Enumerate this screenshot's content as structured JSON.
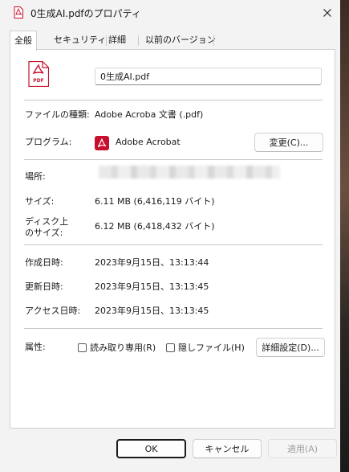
{
  "window": {
    "title": "0生成AI.pdfのプロパティ",
    "title_icon": "pdf-file-icon",
    "close_icon": "close-icon"
  },
  "tabs": [
    {
      "label": "全般",
      "active": true
    },
    {
      "label": "セキュリティ",
      "active": false
    },
    {
      "label": "詳細",
      "active": false
    },
    {
      "label": "以前のバージョン",
      "active": false
    }
  ],
  "general": {
    "file_icon": "pdf-file-icon",
    "file_icon_text": "PDF",
    "file_name": "0生成AI.pdf",
    "type_label": "ファイルの種類:",
    "type_value": "Adobe Acroba 文書 (.pdf)",
    "program_label": "プログラム:",
    "program_icon": "adobe-acrobat-icon",
    "program_value": "Adobe Acrobat",
    "change_button": "変更(C)...",
    "location_label": "場所:",
    "size_label": "サイズ:",
    "size_value": "6.11 MB (6,416,119 バイト)",
    "disk_size_label_line1": "ディスク上",
    "disk_size_label_line2": "のサイズ:",
    "disk_size_value": "6.12 MB (6,418,432 バイト)",
    "created_label": "作成日時:",
    "created_value": "2023年9月15日、13:13:44",
    "modified_label": "更新日時:",
    "modified_value": "2023年9月15日、13:13:45",
    "accessed_label": "アクセス日時:",
    "accessed_value": "2023年9月15日、13:13:45",
    "attributes_label": "属性:",
    "readonly_label": "読み取り専用(R)",
    "readonly_checked": false,
    "hidden_label": "隠しファイル(H)",
    "hidden_checked": false,
    "advanced_button": "詳細設定(D)..."
  },
  "footer": {
    "ok": "OK",
    "cancel": "キャンセル",
    "apply": "適用(A)"
  },
  "colors": {
    "pdf_red": "#c8102e",
    "window_bg": "#f3f3f3",
    "panel_bg": "#ffffff"
  }
}
